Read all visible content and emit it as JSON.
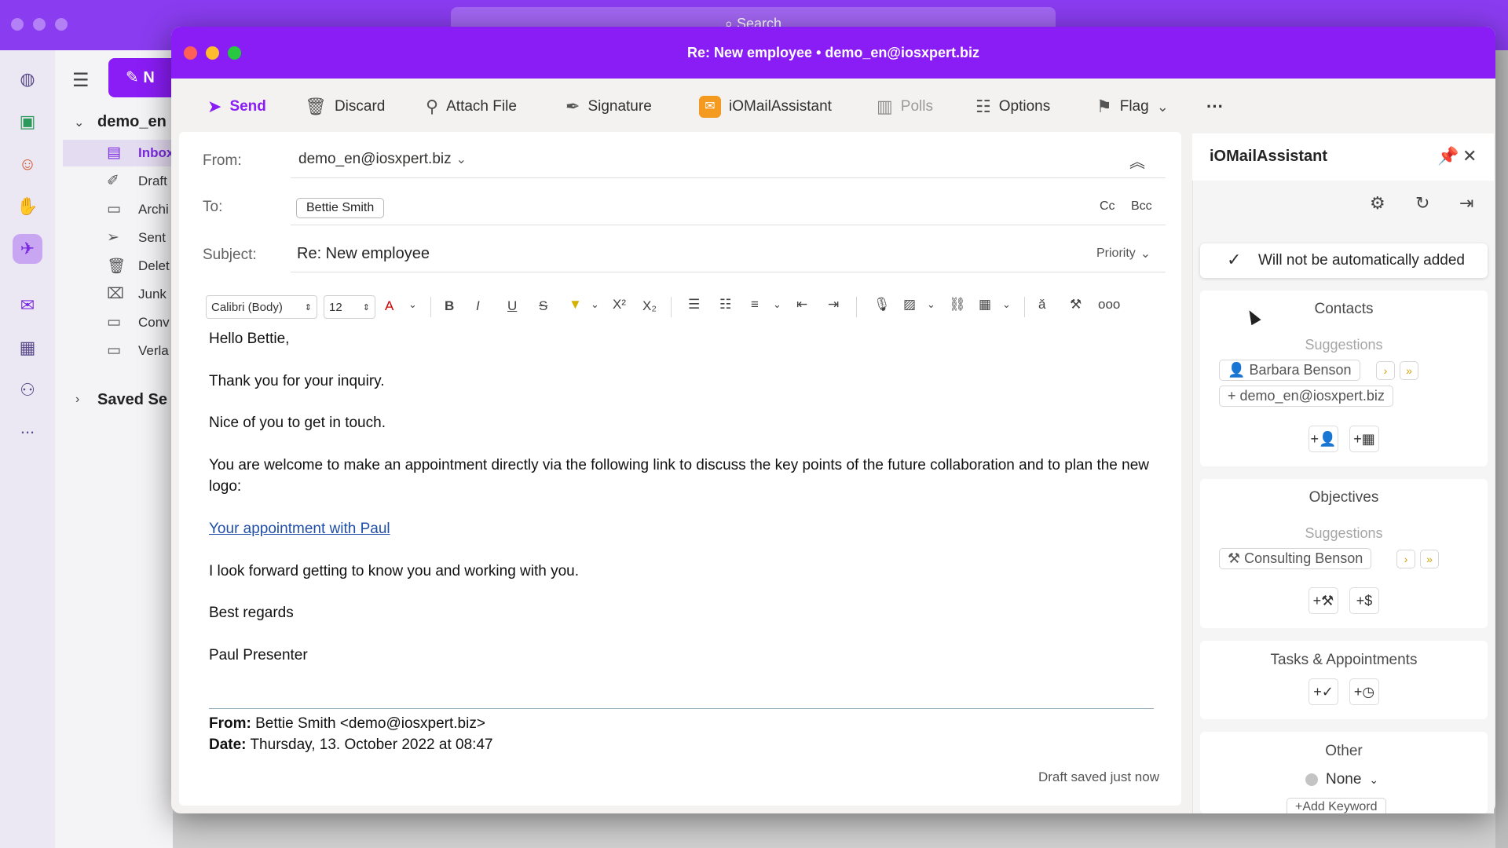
{
  "background_app": {
    "search_placeholder": "Search",
    "account_name": "demo_en",
    "new_button": "N",
    "folders": [
      "Inbox",
      "Draft",
      "Archi",
      "Sent",
      "Delet",
      "Junk",
      "Conv",
      "Verla"
    ],
    "saved_searches": "Saved Se",
    "more": "..."
  },
  "window": {
    "title": "Re: New employee • demo_en@iosxpert.biz"
  },
  "toolbar": {
    "send": "Send",
    "discard": "Discard",
    "attach_file": "Attach File",
    "signature": "Signature",
    "iomail": "iOMailAssistant",
    "polls": "Polls",
    "options": "Options",
    "flag": "Flag",
    "more": "···"
  },
  "compose": {
    "from_label": "From:",
    "from_value": "demo_en@iosxpert.biz",
    "to_label": "To:",
    "to_recipient": "Bettie Smith",
    "cc": "Cc",
    "bcc": "Bcc",
    "subject_label": "Subject:",
    "subject_value": "Re: New employee",
    "priority": "Priority"
  },
  "format_bar": {
    "font": "Calibri (Body)",
    "size": "12"
  },
  "body": {
    "greeting": "Hello Bettie,",
    "line1": "Thank you for your inquiry.",
    "line2": "Nice of you to get in touch.",
    "line3": "You are welcome to make an appointment directly via the following link to discuss the key points of the future collaboration and to plan the new logo:",
    "link": "Your appointment with Paul",
    "line4": "I look forward getting to know you and working with you.",
    "closing": "Best regards",
    "signature": "Paul Presenter",
    "quote_from_label": "From:",
    "quote_from_value": "Bettie Smith <demo@iosxpert.biz>",
    "quote_date_label": "Date:",
    "quote_date_value": "Thursday, 13. October 2022 at 08:47",
    "draft_status": "Draft saved just now"
  },
  "pane": {
    "title": "iOMailAssistant",
    "notice": "Will not be automatically added",
    "contacts": {
      "title": "Contacts",
      "suggestions": "Suggestions",
      "items": [
        "Barbara Benson",
        "demo_en@iosxpert.biz"
      ]
    },
    "objectives": {
      "title": "Objectives",
      "suggestions": "Suggestions",
      "items": [
        "Consulting Benson"
      ]
    },
    "tasks": {
      "title": "Tasks & Appointments"
    },
    "other": {
      "title": "Other",
      "none": "None",
      "add_keyword": "+Add Keyword"
    }
  },
  "colors": {
    "brand_purple": "#8a1cf5",
    "send_purple": "#8a1cf5",
    "link_blue": "#1f4ea8",
    "chevron_gold": "#d4a100"
  }
}
